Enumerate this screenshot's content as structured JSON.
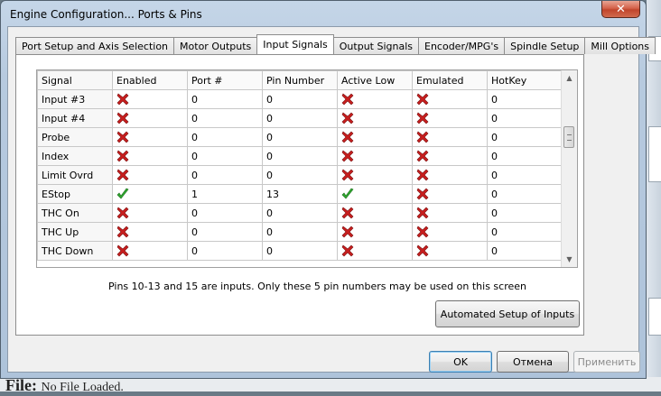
{
  "window": {
    "title": "Engine Configuration... Ports & Pins"
  },
  "tabs": [
    {
      "label": "Port Setup and Axis Selection",
      "active": false
    },
    {
      "label": "Motor Outputs",
      "active": false
    },
    {
      "label": "Input Signals",
      "active": true
    },
    {
      "label": "Output Signals",
      "active": false
    },
    {
      "label": "Encoder/MPG's",
      "active": false
    },
    {
      "label": "Spindle Setup",
      "active": false
    },
    {
      "label": "Mill Options",
      "active": false
    }
  ],
  "grid": {
    "columns": [
      "Signal",
      "Enabled",
      "Port #",
      "Pin Number",
      "Active Low",
      "Emulated",
      "HotKey"
    ],
    "rows": [
      {
        "signal": "Input #3",
        "enabled": "x-icon",
        "port": "0",
        "pin": "0",
        "active_low": "x-icon",
        "emulated": "x-icon",
        "hotkey": "0"
      },
      {
        "signal": "Input #4",
        "enabled": "x-icon",
        "port": "0",
        "pin": "0",
        "active_low": "x-icon",
        "emulated": "x-icon",
        "hotkey": "0"
      },
      {
        "signal": "Probe",
        "enabled": "x-icon",
        "port": "0",
        "pin": "0",
        "active_low": "x-icon",
        "emulated": "x-icon",
        "hotkey": "0"
      },
      {
        "signal": "Index",
        "enabled": "x-icon",
        "port": "0",
        "pin": "0",
        "active_low": "x-icon",
        "emulated": "x-icon",
        "hotkey": "0"
      },
      {
        "signal": "Limit Ovrd",
        "enabled": "x-icon",
        "port": "0",
        "pin": "0",
        "active_low": "x-icon",
        "emulated": "x-icon",
        "hotkey": "0"
      },
      {
        "signal": "EStop",
        "enabled": "check-icon",
        "port": "1",
        "pin": "13",
        "active_low": "check-icon",
        "emulated": "x-icon",
        "hotkey": "0"
      },
      {
        "signal": "THC On",
        "enabled": "x-icon",
        "port": "0",
        "pin": "0",
        "active_low": "x-icon",
        "emulated": "x-icon",
        "hotkey": "0"
      },
      {
        "signal": "THC Up",
        "enabled": "x-icon",
        "port": "0",
        "pin": "0",
        "active_low": "x-icon",
        "emulated": "x-icon",
        "hotkey": "0"
      },
      {
        "signal": "THC Down",
        "enabled": "x-icon",
        "port": "0",
        "pin": "0",
        "active_low": "x-icon",
        "emulated": "x-icon",
        "hotkey": "0"
      }
    ]
  },
  "note": "Pins 10-13 and 15 are inputs. Only these 5 pin numbers may be used on this screen",
  "buttons": {
    "automated_setup": "Automated Setup of Inputs",
    "ok": "OK",
    "cancel": "Отмена",
    "apply": "Применить"
  },
  "background_app": {
    "status_text": "File:",
    "status_value": "No File Loaded."
  },
  "colors": {
    "cross": "#c81e1e",
    "check": "#2fa82f",
    "title_bar": "#b7cadf"
  }
}
